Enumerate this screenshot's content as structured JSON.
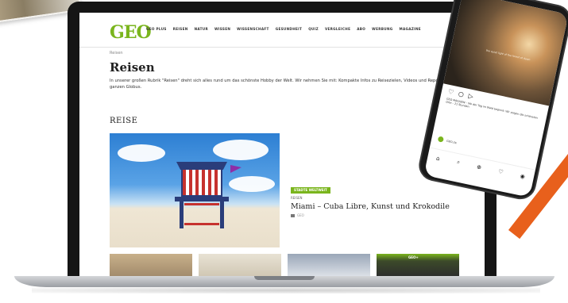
{
  "site": {
    "logo": "GEO",
    "nav": [
      "GEO PLUS",
      "REISEN",
      "NATUR",
      "WISSEN",
      "WISSENSCHAFT",
      "GESUNDHEIT",
      "QUIZ",
      "VERGLEICHE",
      "ABO",
      "WERBUNG",
      "MAGAZINE"
    ],
    "breadcrumb": "Reisen",
    "page_title": "Reisen",
    "intro": "In unserer großen Rubrik \"Reisen\" dreht sich alles rund um das schönste Hobby der Welt. Wir nehmen Sie mit: Kompakte Infos zu Reisezielen, Videos und Reportagen mit um den ganzen Globus.",
    "section_title": "REISE"
  },
  "featured": {
    "badge": "STADTE WELTWEIT",
    "kicker": "REISEN",
    "title": "Miami – Cuba Libre, Kunst und Krokodile",
    "meta": "GEO"
  },
  "thumbnails": [
    {
      "badge": ""
    },
    {
      "badge": ""
    },
    {
      "badge": ""
    },
    {
      "badge": "GEO+"
    }
  ],
  "phone": {
    "quote": "the quiet light of the forest at dawn",
    "actions": [
      "♡",
      "○",
      "▷"
    ],
    "caption": "GEO MAGAZIN – Wo der Tag im Wald beginnt: Wir zeigen die schönsten Orte – 21 Stunden",
    "link_label": "GEO.de",
    "tabbar": [
      "⌂",
      "⌕",
      "⊕",
      "♡",
      "◉"
    ]
  },
  "colors": {
    "brand_green": "#7ab51d",
    "accent_orange": "#e8601c"
  }
}
